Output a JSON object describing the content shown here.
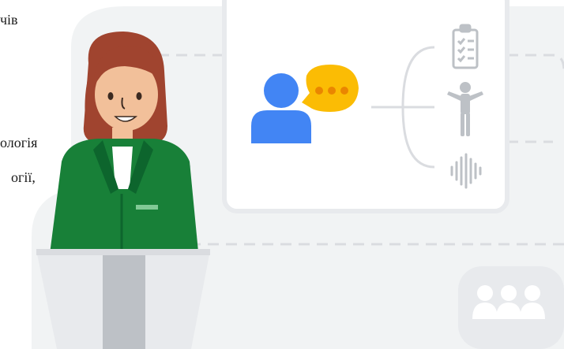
{
  "text_fragments": {
    "line1": "чів",
    "line2": "ологія",
    "line3": "огії,"
  },
  "colors": {
    "backdrop": "#f1f3f4",
    "card": "#ffffff",
    "card_border": "#e8eaed",
    "person_blue": "#4285f4",
    "bubble_yellow": "#fbbc04",
    "bubble_dot": "#ea8600",
    "icon_gray": "#bdc1c6",
    "line_gray": "#dadce0",
    "jacket_green": "#188038",
    "jacket_dark": "#0d652d",
    "hair": "#a0442f",
    "skin": "#f2c09a",
    "podium_light": "#e8eaed",
    "podium_dark": "#bdc1c6"
  },
  "icons": [
    "person-icon",
    "speech-bubble-icon",
    "checklist-icon",
    "gesture-icon",
    "soundwave-icon",
    "audience-icon"
  ]
}
